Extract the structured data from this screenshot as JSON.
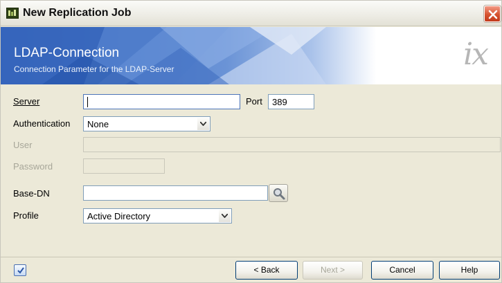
{
  "window": {
    "title": "New Replication Job",
    "app_icon": "app-icon",
    "close_icon": "close-icon"
  },
  "banner": {
    "title": "LDAP-Connection",
    "subtitle": "Connection Parameter for the LDAP-Server",
    "logo": "ix"
  },
  "form": {
    "server": {
      "label": "Server",
      "value": ""
    },
    "port": {
      "label": "Port",
      "value": "389"
    },
    "authentication": {
      "label": "Authentication",
      "value": "None"
    },
    "user": {
      "label": "User",
      "value": ""
    },
    "password": {
      "label": "Password",
      "value": ""
    },
    "base_dn": {
      "label": "Base-DN",
      "value": ""
    },
    "profile": {
      "label": "Profile",
      "value": "Active Directory"
    }
  },
  "footer": {
    "back": "< Back",
    "next": "Next >",
    "cancel": "Cancel",
    "help": "Help"
  },
  "colors": {
    "banner_blue": "#3f6fc6",
    "frame": "#ece9d8",
    "close_red": "#d6522f"
  }
}
